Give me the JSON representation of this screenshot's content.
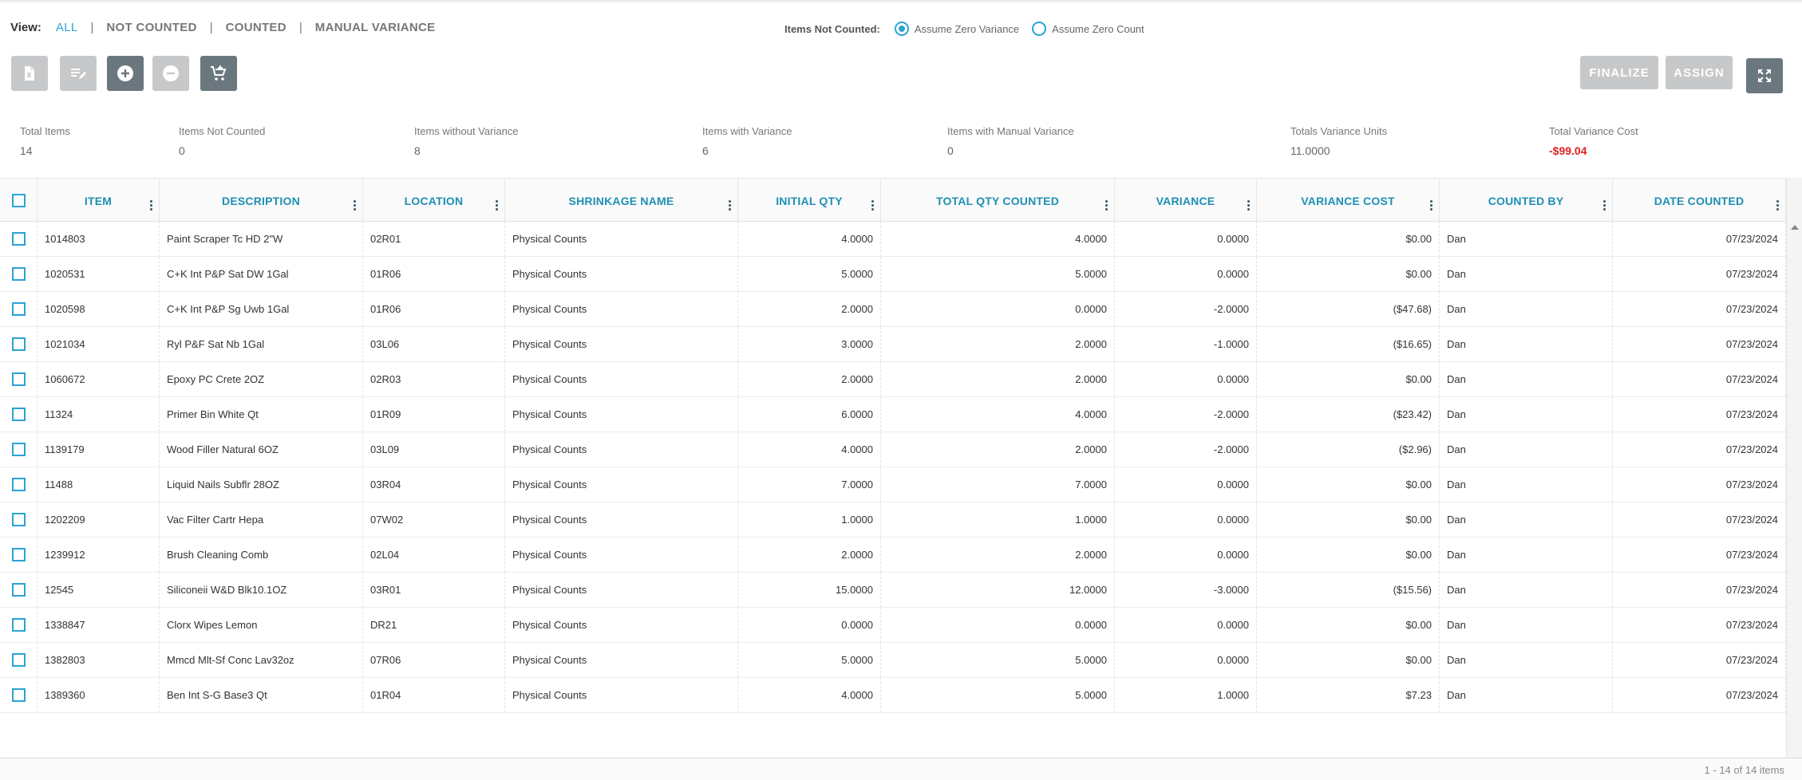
{
  "view": {
    "label": "View:",
    "options": [
      "ALL",
      "NOT COUNTED",
      "COUNTED",
      "MANUAL VARIANCE"
    ],
    "separator": "|"
  },
  "not_counted": {
    "label": "Items Not Counted:",
    "options": [
      "Assume Zero Variance",
      "Assume Zero Count"
    ],
    "selected": "Assume Zero Variance"
  },
  "toolbar": {
    "tools": [
      "excel-export-icon",
      "edit-list-icon",
      "add-circle-icon",
      "remove-circle-icon",
      "add-to-cart-icon"
    ],
    "finalize_label": "FINALIZE",
    "assign_label": "ASSIGN",
    "expand_icon": "expand-icon"
  },
  "summary": {
    "total_items_label": "Total Items",
    "total_items": "14",
    "not_counted_label": "Items Not Counted",
    "not_counted": "0",
    "without_variance_label": "Items without Variance",
    "without_variance": "8",
    "with_variance_label": "Items with Variance",
    "with_variance": "6",
    "manual_variance_label": "Items with Manual Variance",
    "manual_variance": "0",
    "variance_units_label": "Totals Variance Units",
    "variance_units": "11.0000",
    "variance_cost_label": "Total Variance Cost",
    "variance_cost": "-$99.04"
  },
  "colors": {
    "accent": "#2aa3d6",
    "header_text": "#1e8fb5",
    "negative": "#e02020",
    "button_disabled": "#c6c8ca",
    "button_enabled": "#6b777f"
  },
  "table": {
    "columns": [
      "ITEM",
      "DESCRIPTION",
      "LOCATION",
      "SHRINKAGE NAME",
      "INITIAL QTY",
      "TOTAL QTY COUNTED",
      "VARIANCE",
      "VARIANCE COST",
      "COUNTED BY",
      "DATE COUNTED"
    ],
    "rows": [
      [
        "1014803",
        "Paint Scraper Tc HD 2\"W",
        "02R01",
        "Physical Counts",
        "4.0000",
        "4.0000",
        "0.0000",
        "$0.00",
        "Dan",
        "07/23/2024"
      ],
      [
        "1020531",
        "C+K Int P&P Sat DW 1Gal",
        "01R06",
        "Physical Counts",
        "5.0000",
        "5.0000",
        "0.0000",
        "$0.00",
        "Dan",
        "07/23/2024"
      ],
      [
        "1020598",
        "C+K Int P&P Sg Uwb 1Gal",
        "01R06",
        "Physical Counts",
        "2.0000",
        "0.0000",
        "-2.0000",
        "($47.68)",
        "Dan",
        "07/23/2024"
      ],
      [
        "1021034",
        "Ryl P&F Sat Nb 1Gal",
        "03L06",
        "Physical Counts",
        "3.0000",
        "2.0000",
        "-1.0000",
        "($16.65)",
        "Dan",
        "07/23/2024"
      ],
      [
        "1060672",
        "Epoxy PC Crete 2OZ",
        "02R03",
        "Physical Counts",
        "2.0000",
        "2.0000",
        "0.0000",
        "$0.00",
        "Dan",
        "07/23/2024"
      ],
      [
        "11324",
        "Primer Bin White Qt",
        "01R09",
        "Physical Counts",
        "6.0000",
        "4.0000",
        "-2.0000",
        "($23.42)",
        "Dan",
        "07/23/2024"
      ],
      [
        "1139179",
        "Wood Filler Natural 6OZ",
        "03L09",
        "Physical Counts",
        "4.0000",
        "2.0000",
        "-2.0000",
        "($2.96)",
        "Dan",
        "07/23/2024"
      ],
      [
        "11488",
        "Liquid Nails Subflr 28OZ",
        "03R04",
        "Physical Counts",
        "7.0000",
        "7.0000",
        "0.0000",
        "$0.00",
        "Dan",
        "07/23/2024"
      ],
      [
        "1202209",
        "Vac Filter Cartr Hepa",
        "07W02",
        "Physical Counts",
        "1.0000",
        "1.0000",
        "0.0000",
        "$0.00",
        "Dan",
        "07/23/2024"
      ],
      [
        "1239912",
        "Brush Cleaning Comb",
        "02L04",
        "Physical Counts",
        "2.0000",
        "2.0000",
        "0.0000",
        "$0.00",
        "Dan",
        "07/23/2024"
      ],
      [
        "12545",
        "Siliconeii W&D Blk10.1OZ",
        "03R01",
        "Physical Counts",
        "15.0000",
        "12.0000",
        "-3.0000",
        "($15.56)",
        "Dan",
        "07/23/2024"
      ],
      [
        "1338847",
        "Clorx Wipes Lemon",
        "DR21",
        "Physical Counts",
        "0.0000",
        "0.0000",
        "0.0000",
        "$0.00",
        "Dan",
        "07/23/2024"
      ],
      [
        "1382803",
        "Mmcd Mlt-Sf Conc Lav32oz",
        "07R06",
        "Physical Counts",
        "5.0000",
        "5.0000",
        "0.0000",
        "$0.00",
        "Dan",
        "07/23/2024"
      ],
      [
        "1389360",
        "Ben Int S-G Base3 Qt",
        "01R04",
        "Physical Counts",
        "4.0000",
        "5.0000",
        "1.0000",
        "$7.23",
        "Dan",
        "07/23/2024"
      ]
    ]
  },
  "pager": "1 - 14 of 14 items"
}
